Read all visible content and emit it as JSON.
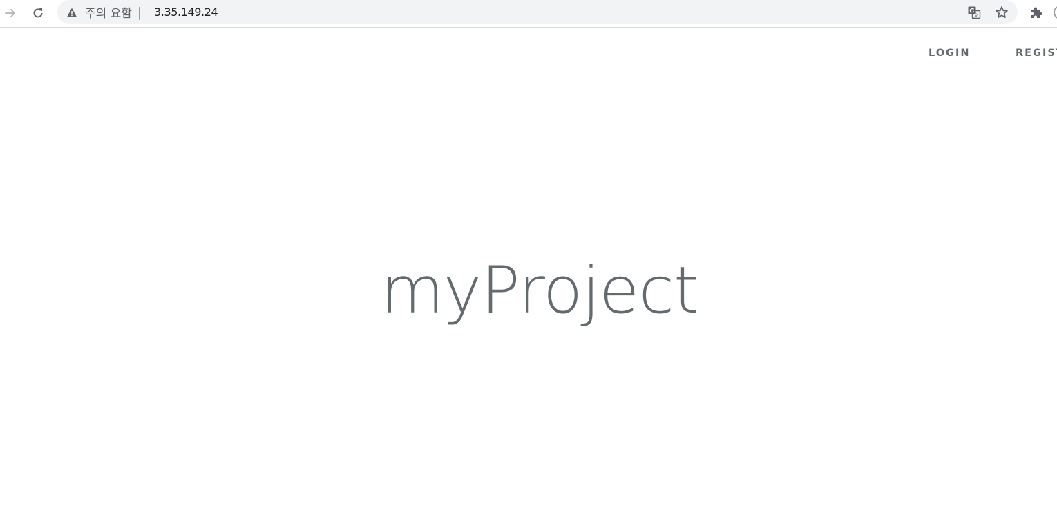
{
  "browser": {
    "security_label": "주의 요함",
    "separator": "|",
    "url": "3.35.149.24"
  },
  "nav": {
    "login": "LOGIN",
    "register": "REGIST"
  },
  "main": {
    "title": "myProject"
  },
  "icons": {
    "forward": "arrow-right-icon",
    "reload": "reload-icon",
    "warning": "warning-triangle-icon",
    "translate": "translate-icon",
    "bookmark": "star-icon",
    "extensions": "puzzle-icon",
    "profile": "avatar"
  },
  "colors": {
    "text_gray": "#636b6f",
    "toolbar_bg": "#f1f3f4",
    "icon_gray": "#5f6368"
  }
}
